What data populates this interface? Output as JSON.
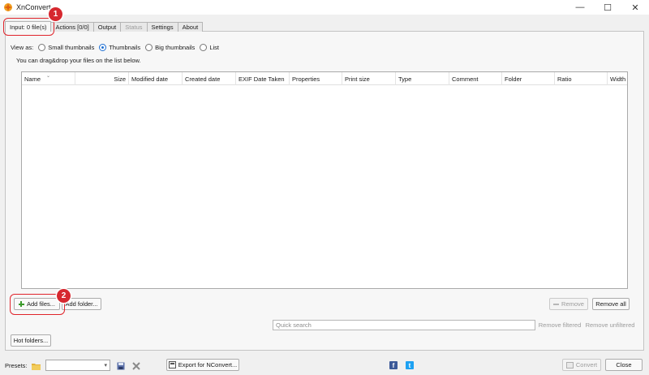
{
  "window": {
    "title": "XnConvert",
    "minimize": "—",
    "maximize": "☐",
    "close": "✕"
  },
  "tabs": [
    {
      "label": "Input: 0 file(s)"
    },
    {
      "label": "Actions [0/0]"
    },
    {
      "label": "Output"
    },
    {
      "label": "Status"
    },
    {
      "label": "Settings"
    },
    {
      "label": "About"
    }
  ],
  "view_as": {
    "label": "View as:",
    "options": [
      "Small thumbnails",
      "Thumbnails",
      "Big thumbnails",
      "List"
    ],
    "selected": "Thumbnails"
  },
  "hint": "You can drag&drop your files on the list below.",
  "columns": [
    "Name",
    "Size",
    "Modified date",
    "Created date",
    "EXIF Date Taken",
    "Properties",
    "Print size",
    "Type",
    "Comment",
    "Folder",
    "Ratio",
    "Width"
  ],
  "buttons": {
    "add_files": "Add files...",
    "add_folder": "Add folder...",
    "remove": "Remove",
    "remove_all": "Remove all",
    "remove_filtered": "Remove filtered",
    "remove_unfiltered": "Remove unfiltered",
    "hot_folders": "Hot folders...",
    "export": "Export for NConvert...",
    "convert": "Convert",
    "close": "Close"
  },
  "search": {
    "placeholder": "Quick search"
  },
  "presets": {
    "label": "Presets:"
  },
  "annotations": {
    "step1": "1",
    "step2": "2"
  },
  "colors": {
    "accent": "#1f6fd1",
    "callout": "#e0242b",
    "facebook": "#3b5998",
    "twitter": "#1da1f2"
  }
}
